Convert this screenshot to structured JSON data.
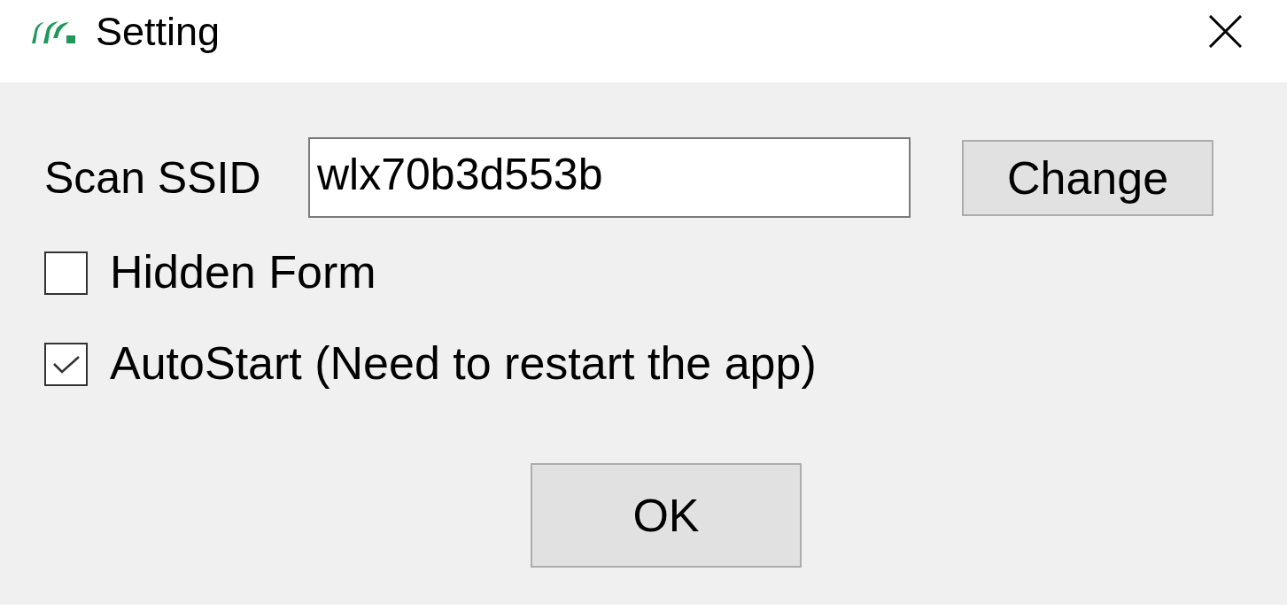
{
  "window": {
    "title": "Setting"
  },
  "scan_ssid": {
    "label": "Scan SSID",
    "value": "wlx70b3d553b",
    "button": "Change"
  },
  "options": [
    {
      "label": "Hidden Form",
      "checked": false
    },
    {
      "label": "AutoStart (Need to restart the app)",
      "checked": true
    }
  ],
  "buttons": [
    "OK"
  ]
}
